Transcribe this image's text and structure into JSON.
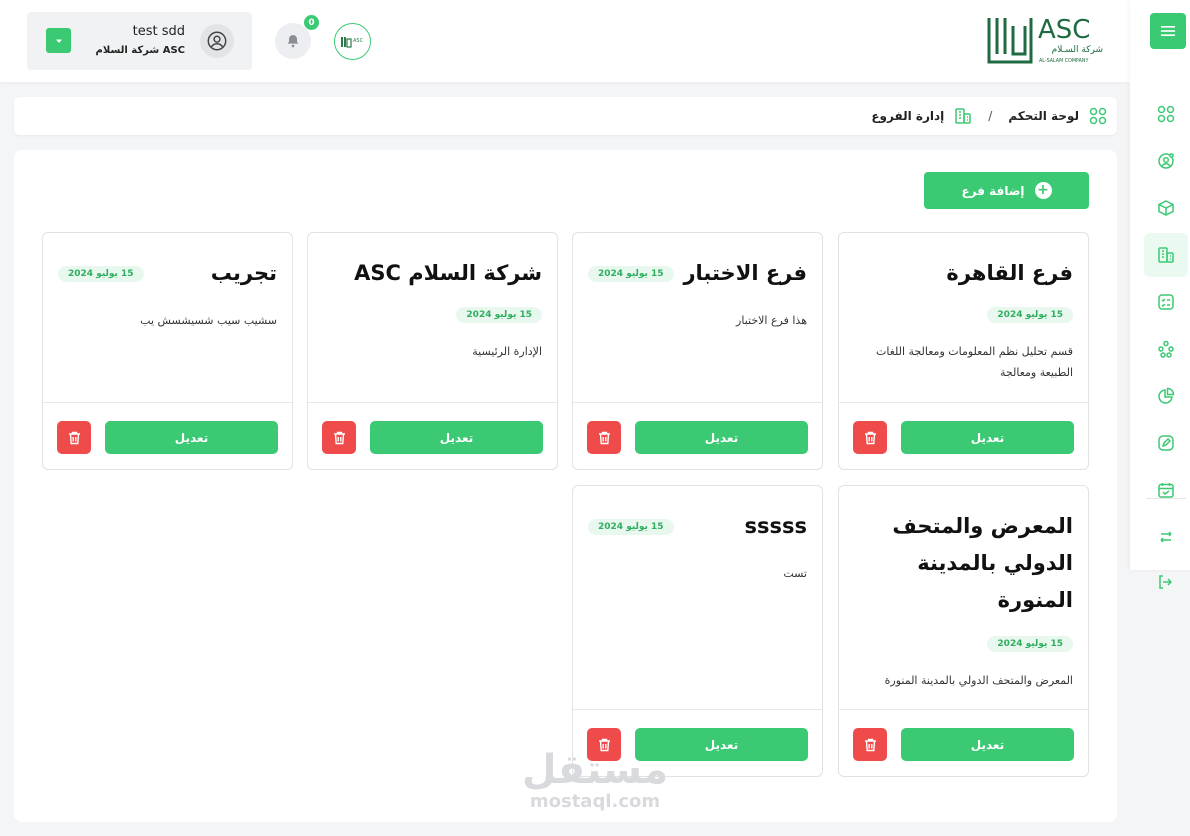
{
  "header": {
    "user_name": "test sdd",
    "user_company": "شركة السلام ASC",
    "notification_count": "0",
    "company_badge_text": "ASC",
    "logo_text": "ASC",
    "logo_subtitle_ar": "شركة السـلام",
    "logo_subtitle_en": "AL-SALAM COMPANY"
  },
  "breadcrumb": {
    "home": "لوحة التحكم",
    "separator": "/",
    "current": "إدارة الفروع"
  },
  "actions": {
    "add_branch": "إضافة فرع"
  },
  "cards": [
    {
      "title": "فرع القاهرة",
      "date": "15 يوليو 2024",
      "description": "قسم تحليل نظم المعلومات ومعالجة اللغات الطبيعة ومعالجة",
      "edit": "تعديل"
    },
    {
      "title": "فرع الاختبار",
      "date": "15 يوليو 2024",
      "description": "هذا فرع الاختبار",
      "edit": "تعديل"
    },
    {
      "title": "شركة السلام ASC",
      "date": "15 يوليو 2024",
      "description": "الإدارة الرئيسية",
      "edit": "تعديل"
    },
    {
      "title": "تجريب",
      "date": "15 يوليو 2024",
      "description": "سشيب سيب شسيشسش يب",
      "edit": "تعديل"
    },
    {
      "title": "المعرض والمتحف الدولي بالمدينة المنورة",
      "date": "15 يوليو 2024",
      "description": "المعرض والمتحف الدولي بالمدينة المنورة",
      "edit": "تعديل"
    },
    {
      "title": "sssss",
      "date": "15 يوليو 2024",
      "description": "تست",
      "edit": "تعديل"
    }
  ],
  "watermark": {
    "ar": "مستقل",
    "en": "mostaql.com"
  },
  "colors": {
    "accent": "#3cc974",
    "danger": "#ef4b4b",
    "badge_bg": "#e9f8ef"
  }
}
